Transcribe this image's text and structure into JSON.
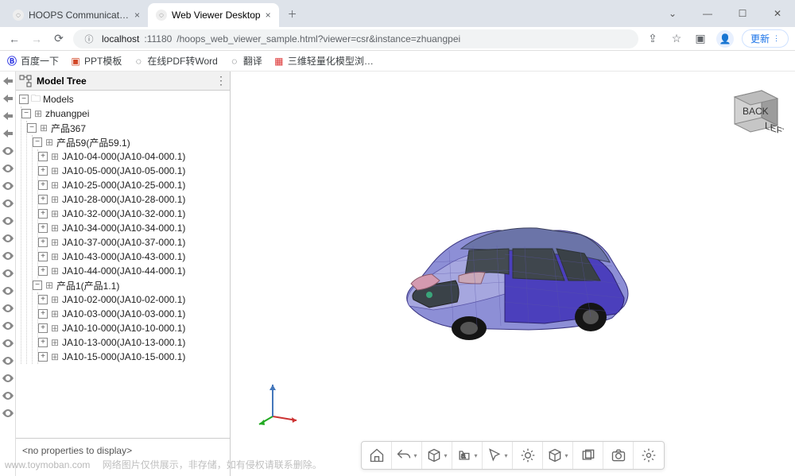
{
  "browser": {
    "tabs": [
      {
        "title": "HOOPS Communicator | Tech",
        "favicon": "globe",
        "active": false
      },
      {
        "title": "Web Viewer Desktop",
        "favicon": "globe",
        "active": true
      }
    ],
    "url_host": "localhost",
    "url_port": ":11180",
    "url_path": "/hoops_web_viewer_sample.html?viewer=csr&instance=zhuangpei",
    "update_label": "更新",
    "bookmarks": [
      {
        "label": "百度一下",
        "icon": "baidu"
      },
      {
        "label": "PPT模板",
        "icon": "ppt"
      },
      {
        "label": "在线PDF转Word",
        "icon": "globe"
      },
      {
        "label": "翻译",
        "icon": "globe"
      },
      {
        "label": "三维轻量化模型浏…",
        "icon": "cube"
      }
    ]
  },
  "panel": {
    "title": "Model Tree",
    "properties_empty": "<no properties to display>"
  },
  "tree": {
    "root": {
      "label": "Models",
      "expanded": true,
      "icon": "folder"
    },
    "l1": {
      "label": "zhuangpei",
      "expanded": true,
      "icon": "part"
    },
    "l2": {
      "label": "产品367",
      "expanded": true,
      "icon": "part"
    },
    "l3a": {
      "label": "产品59(产品59.1)",
      "expanded": true,
      "icon": "part"
    },
    "l3a_items": [
      "JA10-04-000(JA10-04-000.1)",
      "JA10-05-000(JA10-05-000.1)",
      "JA10-25-000(JA10-25-000.1)",
      "JA10-28-000(JA10-28-000.1)",
      "JA10-32-000(JA10-32-000.1)",
      "JA10-34-000(JA10-34-000.1)",
      "JA10-37-000(JA10-37-000.1)",
      "JA10-43-000(JA10-43-000.1)",
      "JA10-44-000(JA10-44-000.1)"
    ],
    "l3b": {
      "label": "产品1(产品1.1)",
      "expanded": true,
      "icon": "part"
    },
    "l3b_items": [
      "JA10-02-000(JA10-02-000.1)",
      "JA10-03-000(JA10-03-000.1)",
      "JA10-10-000(JA10-10-000.1)",
      "JA10-13-000(JA10-13-000.1)",
      "JA10-15-000(JA10-15-000.1)"
    ]
  },
  "nav_cube": {
    "face1": "BACK",
    "face2": "LEFT"
  },
  "toolbar": {
    "items": [
      "home",
      "back",
      "view-cube",
      "annotate",
      "pointer",
      "explode",
      "cuboid",
      "fit",
      "camera",
      "settings"
    ]
  },
  "watermark": {
    "line1": "www.toymoban.com",
    "line2": "网络图片仅供展示，非存储，如有侵权请联系删除。"
  },
  "colors": {
    "car_body_a": "#7c7ed0",
    "car_body_b": "#4b3fbc",
    "car_glass": "#5a5f63",
    "car_grille": "#3a4248",
    "tire": "#1a1a1a",
    "headlight": "#d08da8",
    "cube_face": "#c6c6c6",
    "cube_side": "#9c9c9c",
    "axis_x": "#c33",
    "axis_y": "#2a2",
    "axis_z": "#47b"
  }
}
